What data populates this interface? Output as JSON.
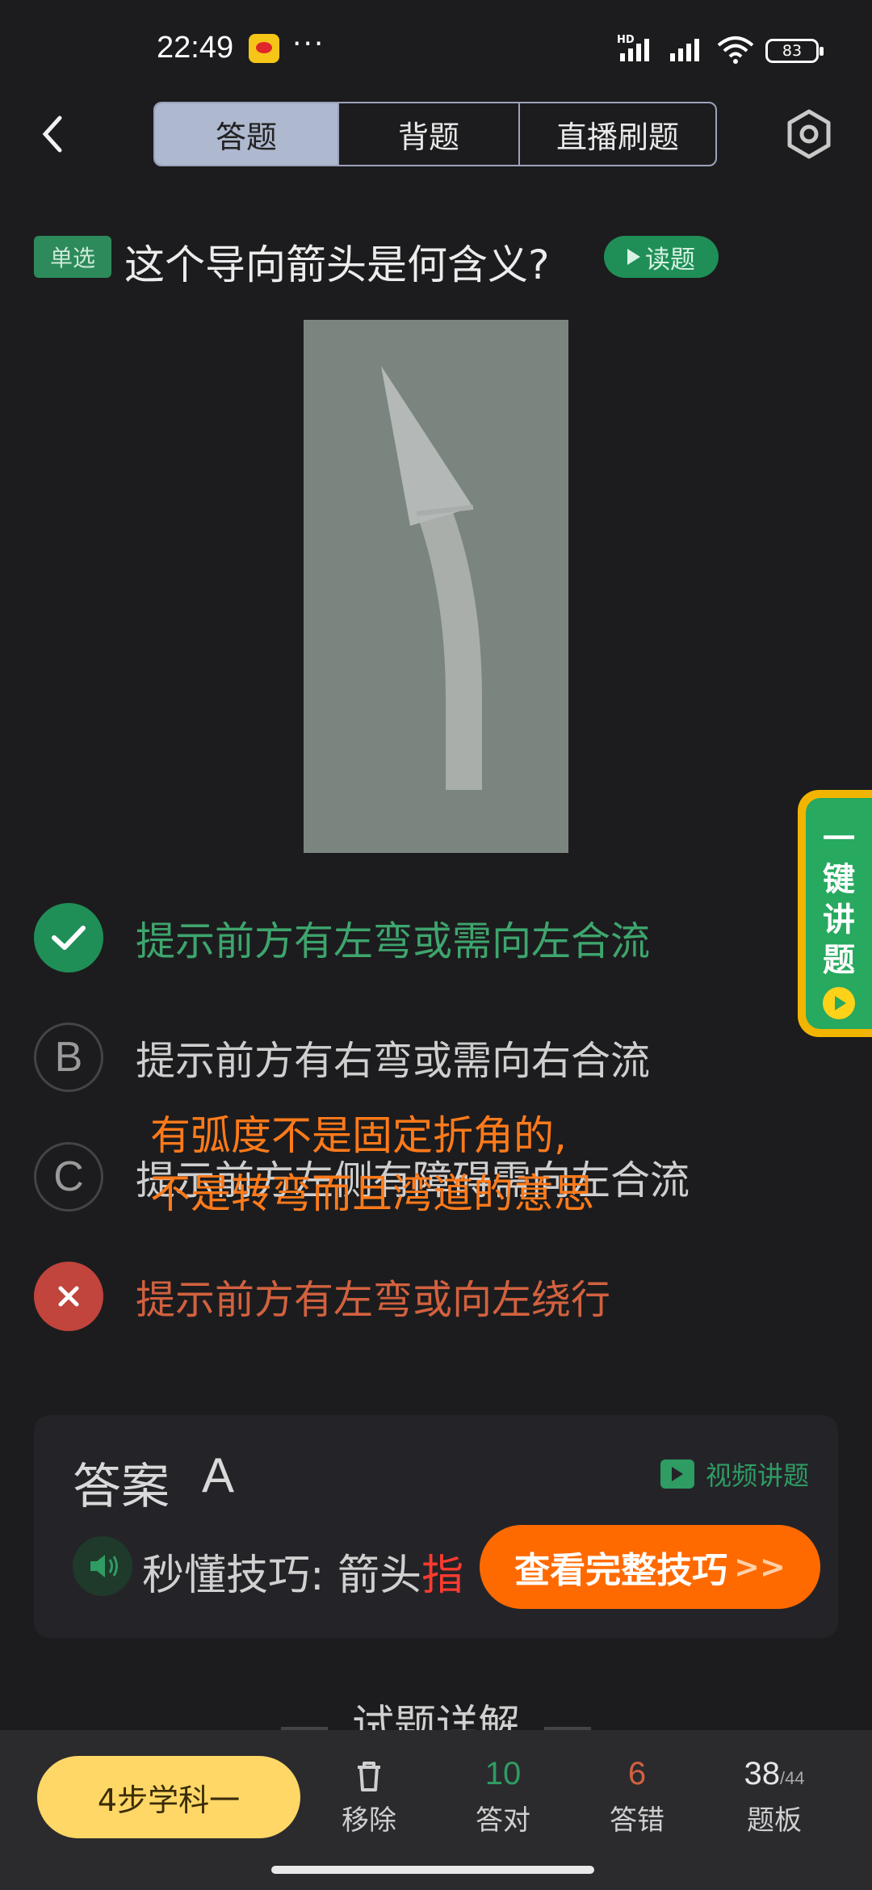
{
  "status_bar": {
    "time": "22:49",
    "app_icon": "weibo-icon",
    "more": "···",
    "hd_badge": "HD",
    "battery": "83"
  },
  "header": {
    "back_icon": "chevron-left-icon",
    "tabs": [
      {
        "label": "答题",
        "active": true
      },
      {
        "label": "背题",
        "active": false
      },
      {
        "label": "直播刷题",
        "active": false
      }
    ],
    "settings_icon": "gear-icon"
  },
  "question": {
    "type_badge": "单选",
    "text": "这个导向箭头是何含义?",
    "read_button": "读题"
  },
  "options": [
    {
      "marker": "✓",
      "state": "correct",
      "text": "提示前方有左弯或需向左合流"
    },
    {
      "marker": "B",
      "state": "normal",
      "text": "提示前方有右弯或需向右合流"
    },
    {
      "marker": "C",
      "state": "normal",
      "text": "提示前方左侧有障碍需向左合流"
    },
    {
      "marker": "✕",
      "state": "wrong",
      "text": "提示前方有左弯或向左绕行"
    }
  ],
  "overlay_note": {
    "line1": "有弧度不是固定折角的,",
    "line2": "不是转弯而且湾道的意思"
  },
  "side_button": {
    "chars": [
      "一",
      "键",
      "讲",
      "题"
    ]
  },
  "answer_card": {
    "label": "答案",
    "letter": "A",
    "video_label": "视频讲题",
    "tip_prefix": "秒懂技巧: 箭头",
    "tip_highlight": "指",
    "full_button": "查看完整技巧",
    "full_button_chevron": ">>"
  },
  "detail_heading": "试题详解",
  "bottom_bar": {
    "study_button": "4步学科一",
    "remove_label": "移除",
    "correct_count": "10",
    "correct_label": "答对",
    "wrong_count": "6",
    "wrong_label": "答错",
    "board_current": "38",
    "board_total": "/44",
    "board_label": "题板"
  },
  "colors": {
    "accent_green": "#1f8f57",
    "wrong_red": "#c1443d",
    "orange": "#ff6a00",
    "study_yellow": "#ffd766"
  }
}
